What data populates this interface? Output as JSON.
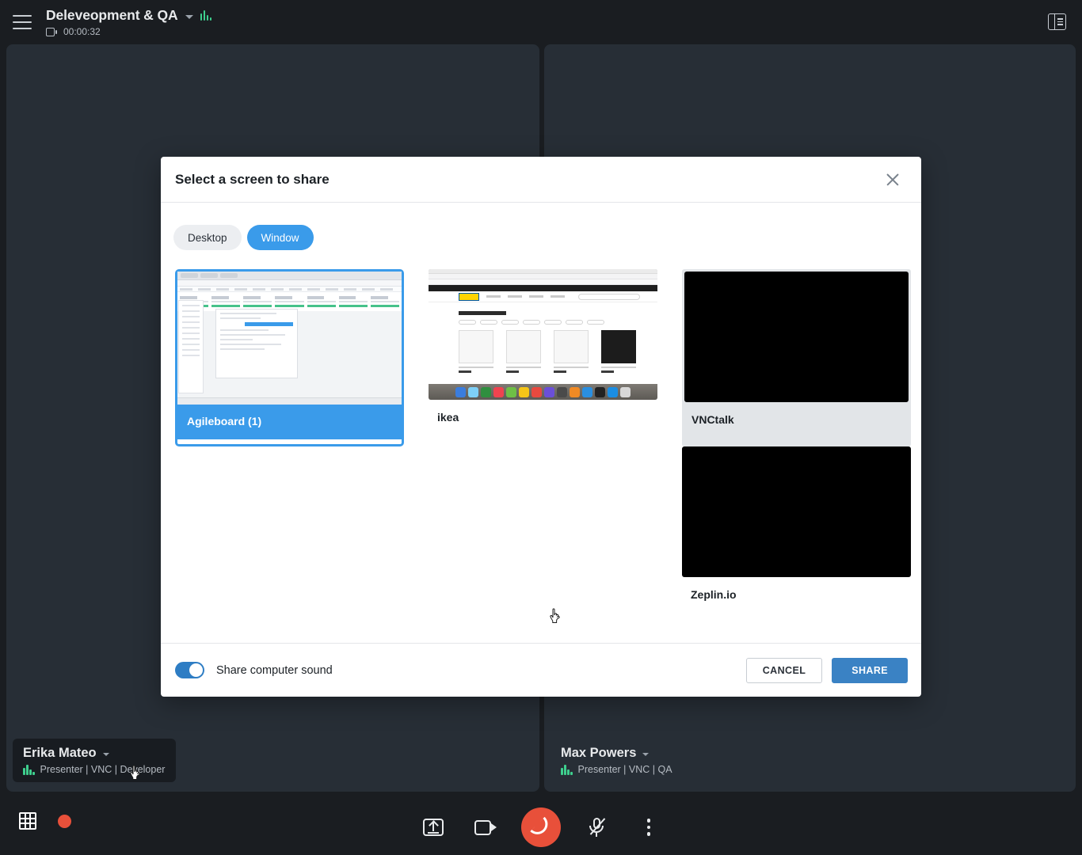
{
  "topbar": {
    "menu_icon": "hamburger-icon",
    "room_title": "Deleveopment & QA",
    "dropdown_icon": "chevron-down-icon",
    "audio_level_icon": "audio-levels-icon",
    "recording_icon": "recording-screen-icon",
    "timer": "00:00:32",
    "panel_toggle_icon": "layout-panel-icon"
  },
  "participants": [
    {
      "name": "Erika Mateo",
      "roles": "Presenter | VNC | Developer",
      "caret_icon": "chevron-down-icon",
      "audio_icon": "audio-levels-icon"
    },
    {
      "name": "Max Powers",
      "roles": "Presenter | VNC | QA",
      "caret_icon": "chevron-down-icon",
      "audio_icon": "audio-levels-icon"
    }
  ],
  "controlbar": {
    "grid_view_icon": "grid-view-icon",
    "record_icon": "record-dot-icon",
    "share_screen_icon": "share-screen-icon",
    "camera_icon": "camera-icon",
    "hangup_icon": "hangup-phone-icon",
    "mic_muted_icon": "microphone-muted-icon",
    "more_icon": "more-options-icon"
  },
  "dialog": {
    "title": "Select a screen to share",
    "close_icon": "close-icon",
    "tabs": [
      {
        "label": "Desktop",
        "active": false
      },
      {
        "label": "Window",
        "active": true
      }
    ],
    "sources": [
      {
        "label": "Agileboard (1)",
        "state": "selected",
        "preview": "agileboard"
      },
      {
        "label": "ikea",
        "state": "normal",
        "preview": "ikea"
      },
      {
        "label": "VNCtalk",
        "state": "hovered",
        "preview": "black"
      },
      {
        "label": "Zeplin.io",
        "state": "normal",
        "preview": "black"
      }
    ],
    "footer": {
      "sound_label": "Share computer sound",
      "sound_enabled": true,
      "cancel_label": "CANCEL",
      "share_label": "SHARE"
    }
  },
  "colors": {
    "accent_blue": "#3a9bea",
    "button_blue": "#3a82c4",
    "toggle_blue": "#2e7dc4",
    "record_red": "#e8503a",
    "audio_green": "#3ecf8e",
    "app_bg": "#1a1d21",
    "tile_bg": "#272e36"
  }
}
